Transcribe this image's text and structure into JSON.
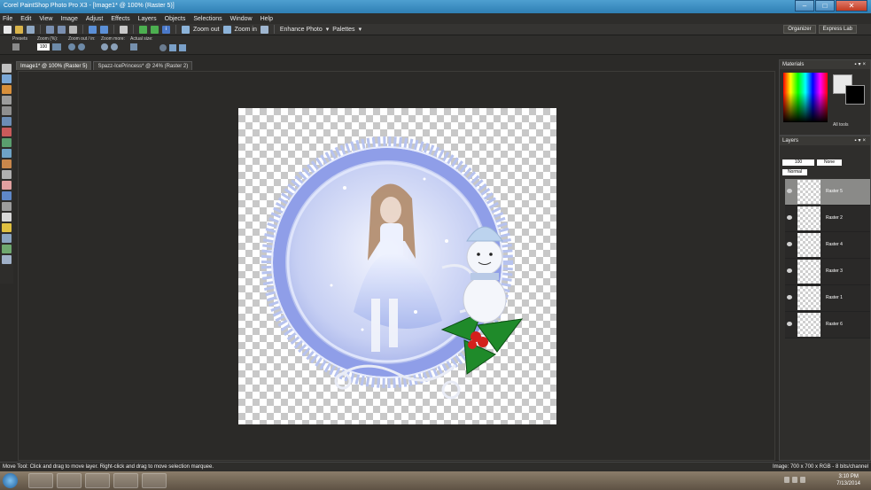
{
  "app": {
    "title": "Corel PaintShop Photo Pro X3 - [Image1* @ 100% (Raster 5)]"
  },
  "window_controls": {
    "minimize": "–",
    "restore": "□",
    "close": "✕"
  },
  "menu": [
    "File",
    "Edit",
    "View",
    "Image",
    "Adjust",
    "Effects",
    "Layers",
    "Objects",
    "Selections",
    "Window",
    "Help"
  ],
  "toolbar": {
    "zoom_out": "Zoom out",
    "zoom_in": "Zoom in",
    "enhance_photo": "Enhance Photo",
    "palettes": "Palettes",
    "organizer": "Organizer",
    "express_lab": "Express Lab"
  },
  "tool_options": {
    "presets": "Presets",
    "zoom_pct": "Zoom (%):",
    "zoom_value": "100",
    "zoom_out_in": "Zoom out / in:",
    "zoom_more": "Zoom more:",
    "actual_size": "Actual size:"
  },
  "tabs": [
    {
      "label": "Image1* @ 100% (Raster 5)"
    },
    {
      "label": "Spazz-IcePrincess* @ 24% (Raster 2)"
    }
  ],
  "palettes": {
    "materials_title": "Materials",
    "all_tools": "All tools",
    "layers_title": "Layers",
    "opacity": "100",
    "mode": "Normal",
    "blend_none": "None"
  },
  "layers": [
    {
      "name": "Raster 5",
      "selected": true
    },
    {
      "name": "Raster 2",
      "selected": false
    },
    {
      "name": "Raster 4",
      "selected": false
    },
    {
      "name": "Raster 3",
      "selected": false
    },
    {
      "name": "Raster 1",
      "selected": false
    },
    {
      "name": "Raster 6",
      "selected": false
    }
  ],
  "status": {
    "hint": "Move Tool: Click and drag to move layer. Right-click and drag to move selection marquee.",
    "image_info": "Image: 700 x 700 x RGB - 8 bits/channel"
  },
  "taskbar": {
    "time": "3:10 PM",
    "date": "7/13/2014"
  },
  "colors": {
    "frame_blue": "#8f9ee8",
    "frame_light": "#c9d2f6",
    "holly_green": "#1f8a2a",
    "berry_red": "#d3201c",
    "snowman_white": "#f4f6fb"
  }
}
